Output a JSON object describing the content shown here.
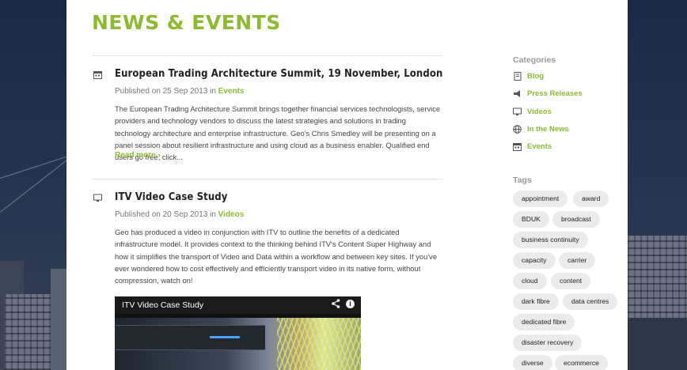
{
  "page": {
    "title": "NEWS & EVENTS"
  },
  "posts": [
    {
      "title": "European Trading Architecture Summit, 19 November, London",
      "published_prefix": "Published on 25 Sep 2013 in ",
      "category": "Events",
      "icon": "calendar-icon",
      "excerpt": "The European Trading Architecture Summit brings together financial services technologists, service providers and technology vendors to discuss the latest strategies and solutions in trading technology architecture and enterprise infrastructure. Geo's Chris Smedley will be presenting on a panel session about resilient infrastructure and using cloud as a business enabler. Qualified end users go free, click...",
      "read_more": "Read more ›"
    },
    {
      "title": "ITV Video Case Study",
      "published_prefix": "Published on 20 Sep 2013 in ",
      "category": "Videos",
      "icon": "monitor-icon",
      "excerpt": "Geo has produced a video in conjunction with ITV to outline the benefits of a dedicated infrastructure model. It provides context to the thinking behind ITV's Content Super Highway and how it simplifies the transport of Video and Data within a workflow and between key sites. If you've ever wondered how to cost effectively and efficiently transport video in its native form, without compression, watch on!",
      "video_title": "ITV Video Case Study",
      "video_share_icon": "share-icon",
      "video_info_icon": "info-icon",
      "video_info_glyph": "i"
    }
  ],
  "sidebar": {
    "categories_heading": "Categories",
    "categories": [
      {
        "label": "Blog",
        "icon": "document-icon"
      },
      {
        "label": "Press Releases",
        "icon": "megaphone-icon"
      },
      {
        "label": "Videos",
        "icon": "monitor-icon"
      },
      {
        "label": "In the News",
        "icon": "globe-icon"
      },
      {
        "label": "Events",
        "icon": "calendar-icon"
      }
    ],
    "tags_heading": "Tags",
    "tags": [
      "appointment",
      "award",
      "BDUK",
      "broadcast",
      "business continuity",
      "capacity",
      "carrier",
      "cloud",
      "content",
      "dark fibre",
      "data centres",
      "dedicated fibre",
      "disaster recovery",
      "diverse",
      "ecommerce"
    ]
  },
  "colors": {
    "accent": "#8dbb2f",
    "text": "#444444",
    "tag_bg": "#ebebeb"
  }
}
